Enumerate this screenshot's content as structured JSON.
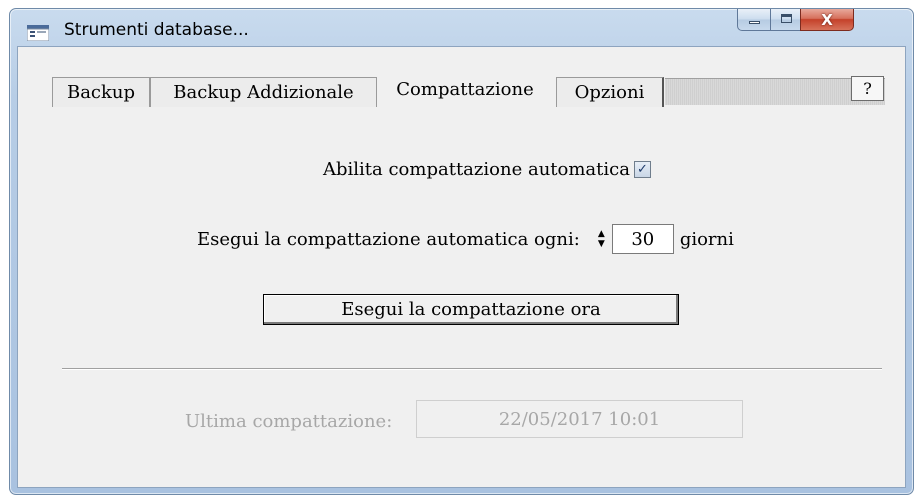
{
  "window": {
    "title": "Strumenti database..."
  },
  "titlebar_buttons": {
    "close_glyph": "X",
    "icons": [
      "minimize-icon",
      "maximize-icon",
      "close-icon"
    ]
  },
  "tabs": [
    {
      "label": "Backup",
      "active": false
    },
    {
      "label": "Backup Addizionale",
      "active": false
    },
    {
      "label": "Compattazione",
      "active": true
    },
    {
      "label": "Opzioni",
      "active": false
    }
  ],
  "help": {
    "label": "?"
  },
  "compattazione": {
    "auto_label": "Abilita compattazione automatica",
    "auto_checked": true,
    "check_glyph": "✓",
    "every_label": "Esegui la compattazione automatica ogni:",
    "every_value": "30",
    "every_unit": "giorni",
    "run_now_label": "Esegui la compattazione ora",
    "last_label": "Ultima compattazione:",
    "last_value": "22/05/2017 10:01"
  },
  "colors": {
    "disabled_text": "#a7a7a7",
    "close_button": "#c4412a"
  }
}
